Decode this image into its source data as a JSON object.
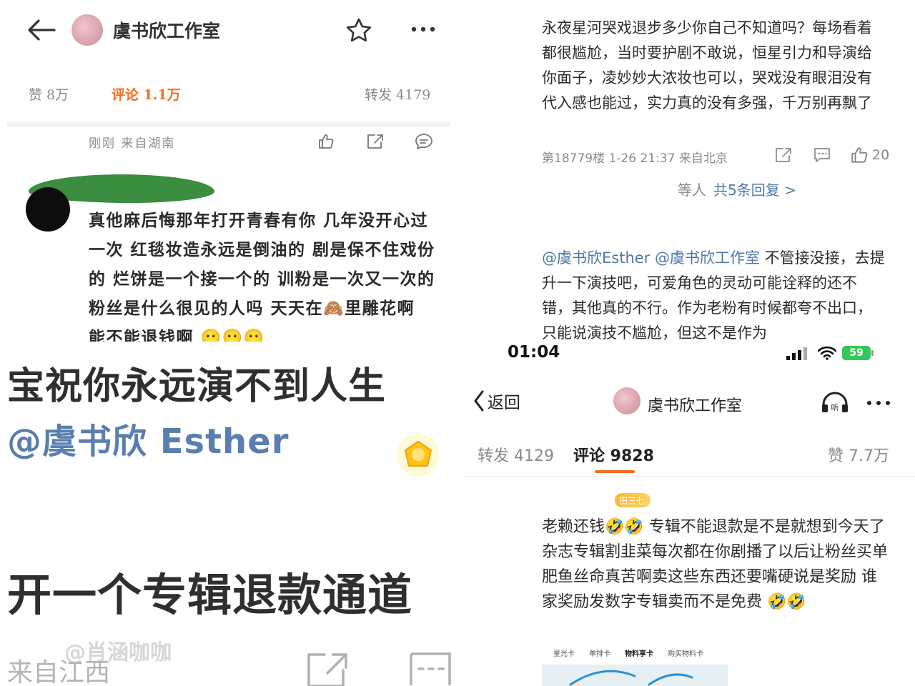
{
  "top_left": {
    "title": "虞书欣工作室",
    "stats": {
      "likes": "赞 8万",
      "comments": "评论 1.1万",
      "reposts": "转发 4179"
    },
    "meta": "刚刚 来自湖南",
    "comment_text": "真他麻后悔那年打开青春有你 几年没开心过一次 红毯妆造永远是倒油的 剧是保不住戏份的 烂饼是一个接一个的 训粉是一次又一次的 粉丝是什么很见的人吗 天天在🙈里雕花啊 能不能退钱啊 😶😶😶",
    "icons": [
      "back-arrow-icon",
      "star-icon",
      "more-dots-icon",
      "thumb-up-icon",
      "share-icon",
      "comment-icon"
    ]
  },
  "top_right": {
    "comment1": "永夜星河哭戏退步多少你自己不知道吗？每场看着都很尴尬，当时要护剧不敢说，恒星引力和导演给你面子，凌妙妙大浓妆也可以，哭戏没有眼泪没有代入感也能过，实力真的没有多强，千万别再飘了",
    "comment1_meta": "第18779楼 1-26 21:37 来自北京",
    "comment1_likes": "20",
    "replies_prefix": "等人",
    "replies_link": "共5条回复 >",
    "comment2_mention": "@虞书欣Esther @虞书欣工作室",
    "comment2_text": " 不管接没接，去提升一下演技吧，可爱角色的灵动可能诠释的还不错，其他真的不行。作为老粉有时候都夸不出口，只能说演技不尴尬，但这不是作为"
  },
  "bottom_left": {
    "line1": "宝祝你永远演不到人生",
    "mention": "@虞书欣 Esther",
    "line2": "开一个专辑退款通道",
    "watermark": "@肖涵咖咖",
    "footer_text": "来自江西"
  },
  "bottom_right": {
    "status": {
      "time": "01:04",
      "battery": "59"
    },
    "nav": {
      "back": "返回",
      "title": "虞书欣工作室"
    },
    "tabs": {
      "reposts": "转发 4129",
      "comments": "评论 9828",
      "likes": "赞 7.7万"
    },
    "badge": "田三七",
    "comment_text": "老赖还钱🤣🤣 专辑不能退款是不是就想到今天了 杂志专辑割韭菜每次都在你剧播了以后让粉丝买单 肥鱼丝命真苦啊卖这些东西还要嘴硬说是奖励 谁家奖励发数字专辑卖而不是免费 🤣🤣",
    "card_tabs": [
      "星光卡",
      "单排卡",
      "物料享卡",
      "购买物料卡"
    ],
    "accent": "#f26f21"
  }
}
